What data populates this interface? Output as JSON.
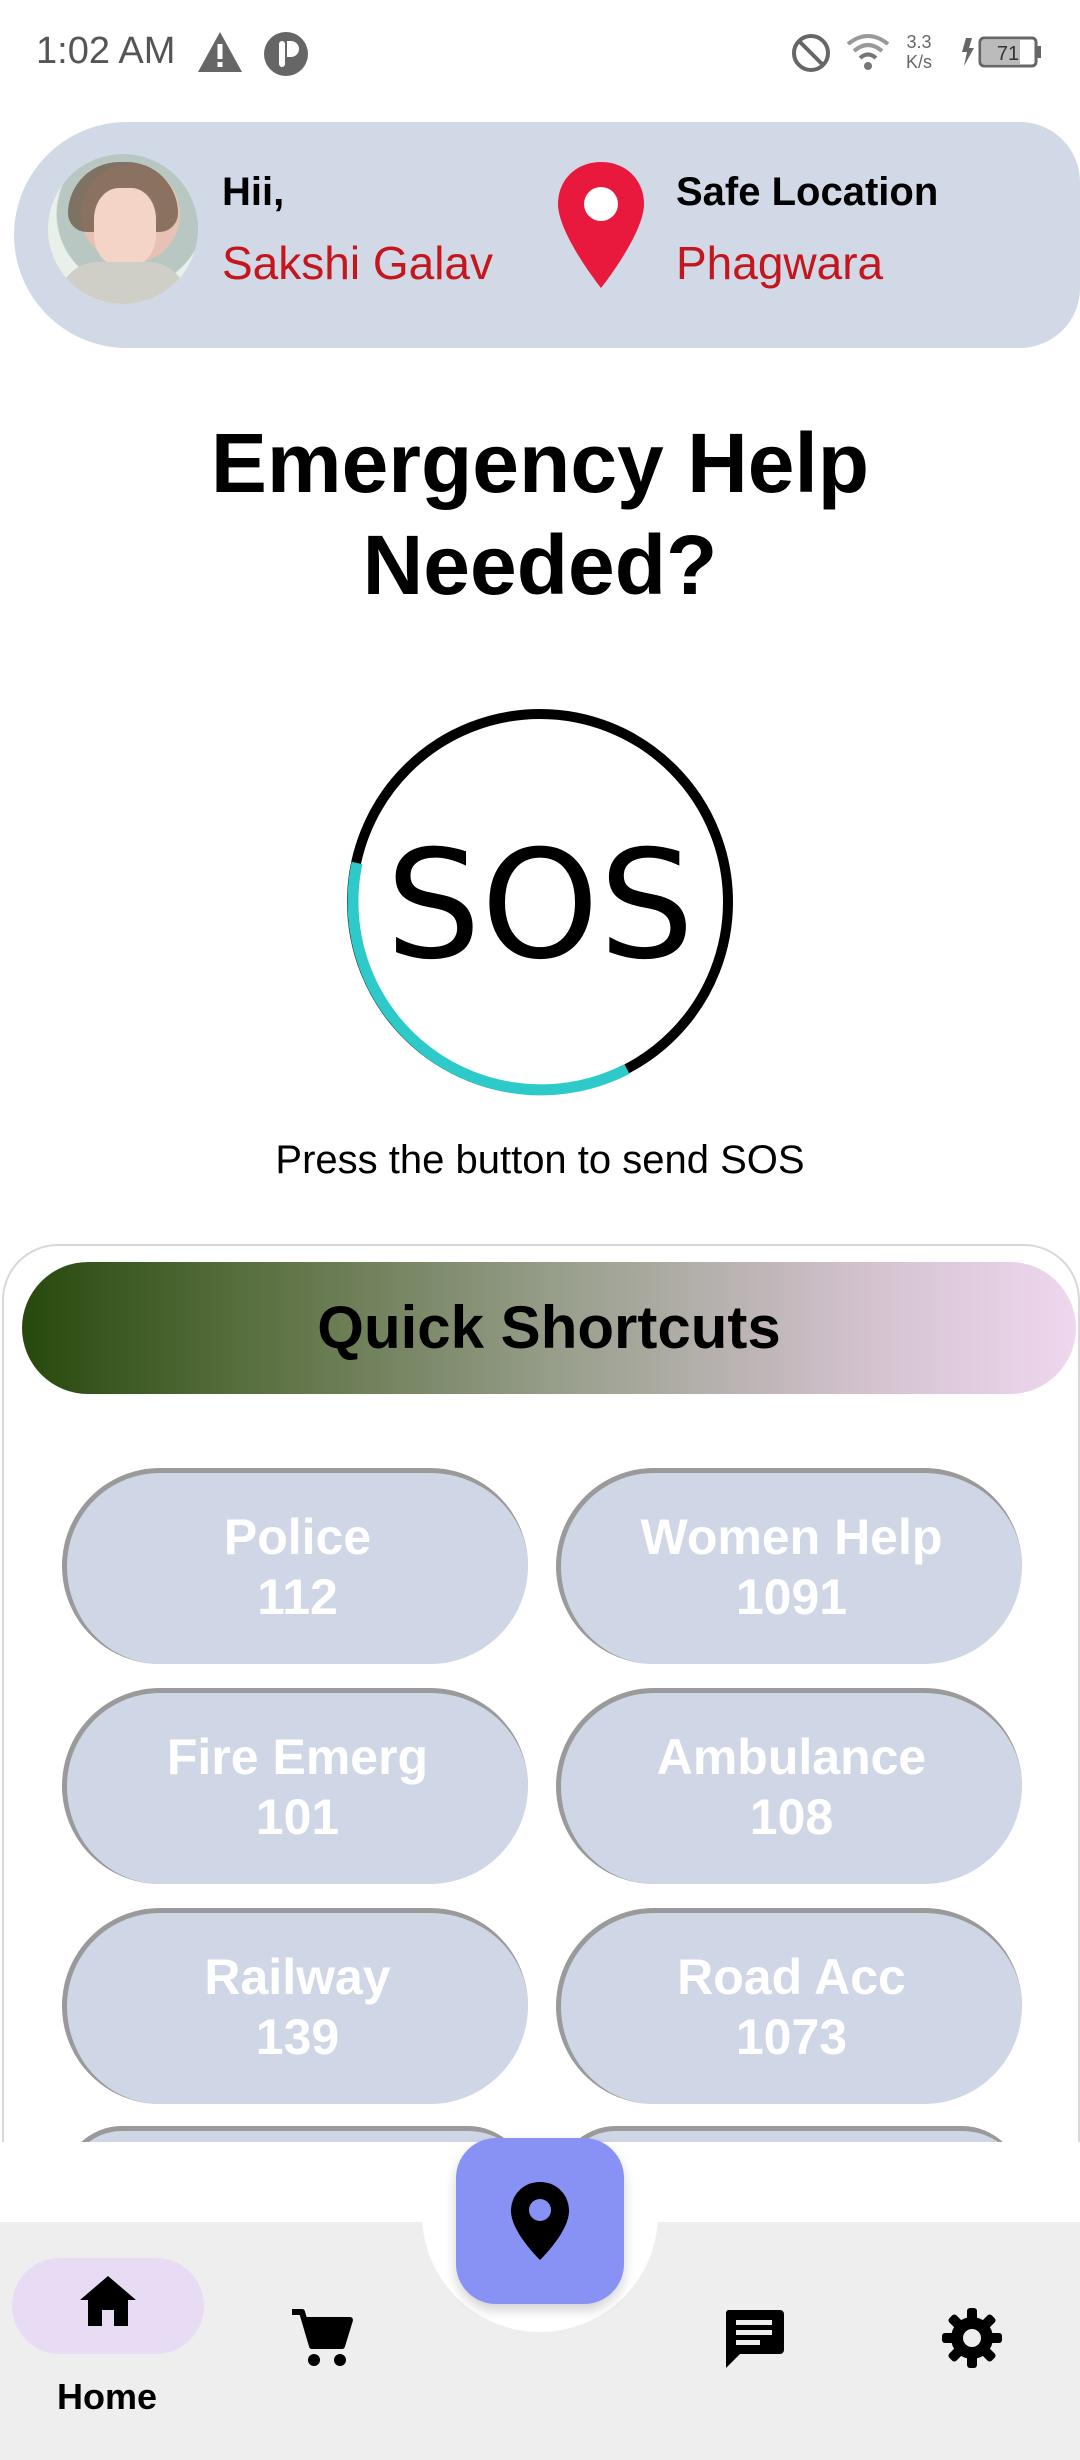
{
  "status_bar": {
    "time": "1:02 AM",
    "speed_value": "3.3",
    "speed_unit": "K/s",
    "battery": "71"
  },
  "header": {
    "greeting": "Hii,",
    "user_name": "Sakshi Galav",
    "location_label": "Safe Location",
    "location_value": "Phagwara"
  },
  "main": {
    "title_line1": "Emergency Help",
    "title_line2": "Needed?",
    "sos_label": "SOS",
    "sos_hint": "Press the button to send SOS"
  },
  "shortcuts": {
    "title": "Quick Shortcuts",
    "items": [
      {
        "name": "Police",
        "number": "112"
      },
      {
        "name": "Women Help",
        "number": "1091"
      },
      {
        "name": "Fire Emerg",
        "number": "101"
      },
      {
        "name": "Ambulance",
        "number": "108"
      },
      {
        "name": "Railway",
        "number": "139"
      },
      {
        "name": "Road Acc",
        "number": "1073"
      }
    ]
  },
  "bottom_nav": {
    "items": [
      {
        "label": "Home",
        "icon": "home-icon"
      },
      {
        "label": "",
        "icon": "cart-icon"
      },
      {
        "label": "",
        "icon": "location-pin-icon"
      },
      {
        "label": "",
        "icon": "chat-icon"
      },
      {
        "label": "",
        "icon": "settings-icon"
      }
    ]
  },
  "colors": {
    "accent_red": "#c4161c",
    "header_bg": "#d2d9e6",
    "fab_bg": "#8892f4",
    "sos_progress": "#2ec9c9"
  }
}
